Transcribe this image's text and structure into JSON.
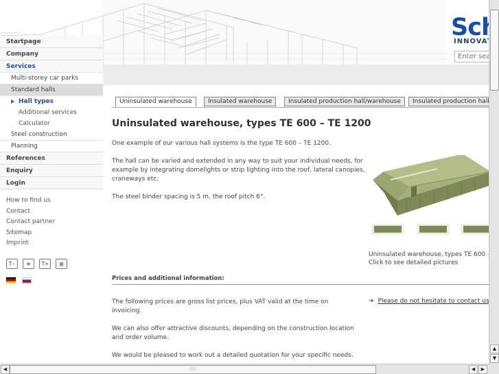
{
  "header": {
    "logo_text": "Sch",
    "logo_subtext": "INNOVAT",
    "search_placeholder": "Enter sear"
  },
  "sidebar": {
    "main_items": [
      {
        "label": "Startpage"
      },
      {
        "label": "Company"
      },
      {
        "label": "Services"
      },
      {
        "label": "References"
      },
      {
        "label": "Enquiry"
      },
      {
        "label": "Login"
      }
    ],
    "services_children": [
      {
        "label": "Multi-storey car parks"
      },
      {
        "label": "Standard halls"
      },
      {
        "label": "Hall types"
      },
      {
        "label": "Additional services"
      },
      {
        "label": "Calculator"
      },
      {
        "label": "Steel construction"
      },
      {
        "label": "Planning"
      }
    ],
    "footer_links": [
      {
        "label": "How to find us"
      },
      {
        "label": "Contact"
      },
      {
        "label": "Contact partner"
      },
      {
        "label": "Sitemap"
      },
      {
        "label": "Imprint"
      }
    ],
    "tools": [
      {
        "icon": "text-smaller-icon",
        "glyph": "T-"
      },
      {
        "icon": "text-view-icon",
        "glyph": "≡"
      },
      {
        "icon": "text-larger-icon",
        "glyph": "T+"
      },
      {
        "icon": "print-icon",
        "glyph": "▤"
      }
    ],
    "languages": [
      {
        "icon": "flag-german-icon"
      },
      {
        "icon": "flag-russian-icon"
      }
    ]
  },
  "tabs": [
    {
      "label": "Uninsulated warehouse",
      "active": true
    },
    {
      "label": "Insulated warehouse",
      "active": false
    },
    {
      "label": "Insulated production hall/warehouse",
      "active": false
    },
    {
      "label": "Insulated production hall",
      "active": false
    }
  ],
  "content": {
    "title": "Uninsulated warehouse, types TE 600 – TE 1200",
    "paragraphs": [
      "One example of our various hall systems is the type TE 600 – TE 1200.",
      "The hall can be varied and extended in any way to suit your individual needs, for example by integrating domelights or strip lighting into the roof, lateral canopies, craneways etc.",
      "The steel binder spacing is 5 m, the roof pitch 6°."
    ],
    "caption_line1": "Uninsulated warehouse, types TE 600 – T",
    "caption_line2": "Click to see detailed pictures",
    "prices_heading": "Prices and additional information:",
    "prices_paragraphs": [
      "The following prices are gross list prices, plus VAT valid at the time on invoicing.",
      "We can also offer attractive discounts, depending on the construction location and order volume.",
      "We would be pleased to work out a detailed quotation for your specific needs."
    ],
    "contact_link": "Please do not hesitate to contact us!"
  },
  "colors": {
    "accent": "#1f4fa0",
    "logo": "#1a4fa0",
    "hall_green": "#7d8a58"
  }
}
